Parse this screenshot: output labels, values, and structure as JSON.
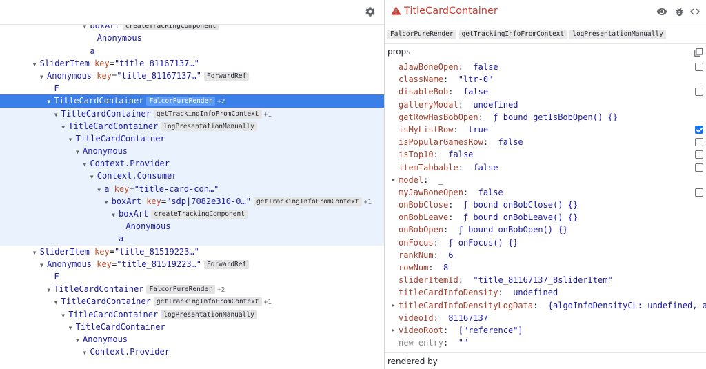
{
  "colors": {
    "selection": "#3b80e8",
    "subtree_highlight": "#eaf2fd",
    "component_name": "#1a1aa6",
    "attr_key": "#c4502b",
    "warning_title": "#d33b2e",
    "checkbox_checked": "#1a73e8"
  },
  "tree": {
    "settings_icon": "gear-icon",
    "rows": [
      {
        "indent": 11,
        "arrow": "",
        "name": "boxArt",
        "attr": [
          {
            "k": "key",
            "v": "\"sdp|7082e310-0…\""
          }
        ],
        "badge": "getTrackingInfoFromContext",
        "extra": "",
        "state": "obscured"
      },
      {
        "indent": 11,
        "arrow": "▼",
        "name": "boxArt",
        "attr": [],
        "badge": "createTrackingComponent",
        "extra": "",
        "state": ""
      },
      {
        "indent": 12,
        "arrow": "",
        "name": "Anonymous",
        "attr": [],
        "badge": "",
        "extra": "",
        "state": ""
      },
      {
        "indent": 11,
        "arrow": "",
        "name": "a",
        "attr": [],
        "badge": "",
        "extra": "",
        "state": ""
      },
      {
        "indent": 4,
        "arrow": "▼",
        "name": "SliderItem",
        "attr": [
          {
            "k": "key",
            "v": "\"title_81167137…\""
          }
        ],
        "badge": "",
        "extra": "",
        "state": ""
      },
      {
        "indent": 5,
        "arrow": "▼",
        "name": "Anonymous",
        "attr": [
          {
            "k": "key",
            "v": "\"title_81167137…\""
          }
        ],
        "badge": "ForwardRef",
        "extra": "",
        "state": ""
      },
      {
        "indent": 6,
        "arrow": "",
        "name": "F",
        "attr": [],
        "badge": "",
        "extra": "",
        "state": ""
      },
      {
        "indent": 6,
        "arrow": "▼",
        "name": "TitleCardContainer",
        "attr": [],
        "badge": "FalcorPureRender",
        "extra": "+2",
        "state": "sel"
      },
      {
        "indent": 7,
        "arrow": "▼",
        "name": "TitleCardContainer",
        "attr": [],
        "badge": "getTrackingInfoFromContext",
        "extra": "+1",
        "state": "sub"
      },
      {
        "indent": 8,
        "arrow": "▼",
        "name": "TitleCardContainer",
        "attr": [],
        "badge": "logPresentationManually",
        "extra": "",
        "state": "sub"
      },
      {
        "indent": 9,
        "arrow": "▼",
        "name": "TitleCardContainer",
        "attr": [],
        "badge": "",
        "extra": "",
        "state": "sub"
      },
      {
        "indent": 10,
        "arrow": "▼",
        "name": "Anonymous",
        "attr": [],
        "badge": "",
        "extra": "",
        "state": "sub"
      },
      {
        "indent": 11,
        "arrow": "▼",
        "name": "Context.Provider",
        "attr": [],
        "badge": "",
        "extra": "",
        "state": "sub"
      },
      {
        "indent": 12,
        "arrow": "▼",
        "name": "Context.Consumer",
        "attr": [],
        "badge": "",
        "extra": "",
        "state": "sub"
      },
      {
        "indent": 13,
        "arrow": "▼",
        "name": "a",
        "attr": [
          {
            "k": "key",
            "v": "\"title-card-con…\""
          }
        ],
        "badge": "",
        "extra": "",
        "state": "sub"
      },
      {
        "indent": 14,
        "arrow": "▼",
        "name": "boxArt",
        "attr": [
          {
            "k": "key",
            "v": "\"sdp|7082e310-0…\""
          }
        ],
        "badge": "getTrackingInfoFromContext",
        "extra": "+1",
        "state": "sub"
      },
      {
        "indent": 15,
        "arrow": "▼",
        "name": "boxArt",
        "attr": [],
        "badge": "createTrackingComponent",
        "extra": "",
        "state": "sub"
      },
      {
        "indent": 16,
        "arrow": "",
        "name": "Anonymous",
        "attr": [],
        "badge": "",
        "extra": "",
        "state": "sub"
      },
      {
        "indent": 15,
        "arrow": "",
        "name": "a",
        "attr": [],
        "badge": "",
        "extra": "",
        "state": "sub"
      },
      {
        "indent": 4,
        "arrow": "▼",
        "name": "SliderItem",
        "attr": [
          {
            "k": "key",
            "v": "\"title_81519223…\""
          }
        ],
        "badge": "",
        "extra": "",
        "state": ""
      },
      {
        "indent": 5,
        "arrow": "▼",
        "name": "Anonymous",
        "attr": [
          {
            "k": "key",
            "v": "\"title_81519223…\""
          }
        ],
        "badge": "ForwardRef",
        "extra": "",
        "state": ""
      },
      {
        "indent": 6,
        "arrow": "",
        "name": "F",
        "attr": [],
        "badge": "",
        "extra": "",
        "state": ""
      },
      {
        "indent": 6,
        "arrow": "▼",
        "name": "TitleCardContainer",
        "attr": [],
        "badge": "FalcorPureRender",
        "extra": "+2",
        "state": ""
      },
      {
        "indent": 7,
        "arrow": "▼",
        "name": "TitleCardContainer",
        "attr": [],
        "badge": "getTrackingInfoFromContext",
        "extra": "+1",
        "state": ""
      },
      {
        "indent": 8,
        "arrow": "▼",
        "name": "TitleCardContainer",
        "attr": [],
        "badge": "logPresentationManually",
        "extra": "",
        "state": ""
      },
      {
        "indent": 9,
        "arrow": "▼",
        "name": "TitleCardContainer",
        "attr": [],
        "badge": "",
        "extra": "",
        "state": ""
      },
      {
        "indent": 10,
        "arrow": "▼",
        "name": "Anonymous",
        "attr": [],
        "badge": "",
        "extra": "",
        "state": ""
      },
      {
        "indent": 11,
        "arrow": "▼",
        "name": "Context.Provider",
        "attr": [],
        "badge": "",
        "extra": "",
        "state": ""
      }
    ]
  },
  "inspector": {
    "title": "TitleCardContainer",
    "warning_icon": "warning-icon",
    "header_icons": [
      "eye-icon",
      "bug-icon",
      "source-code-icon"
    ],
    "hocs": [
      "FalcorPureRender",
      "getTrackingInfoFromContext",
      "logPresentationManually"
    ],
    "props_label": "props",
    "copy_icon": "copy-icon",
    "props": [
      {
        "key": "aJawBoneOpen",
        "value": "false",
        "expand": false,
        "checkbox": "off"
      },
      {
        "key": "className",
        "value": "\"ltr-0\"",
        "expand": false,
        "checkbox": ""
      },
      {
        "key": "disableBob",
        "value": "false",
        "expand": false,
        "checkbox": "off"
      },
      {
        "key": "galleryModal",
        "value": "undefined",
        "expand": false,
        "checkbox": ""
      },
      {
        "key": "getRowHasBobOpen",
        "value": "ƒ bound getIsBobOpen() {}",
        "expand": false,
        "checkbox": ""
      },
      {
        "key": "isMyListRow",
        "value": "true",
        "expand": false,
        "checkbox": "on"
      },
      {
        "key": "isPopularGamesRow",
        "value": "false",
        "expand": false,
        "checkbox": "off"
      },
      {
        "key": "isTop10",
        "value": "false",
        "expand": false,
        "checkbox": "off"
      },
      {
        "key": "itemTabbable",
        "value": "false",
        "expand": false,
        "checkbox": "off"
      },
      {
        "key": "model",
        "value": "_",
        "expand": true,
        "checkbox": ""
      },
      {
        "key": "myJawBoneOpen",
        "value": "false",
        "expand": false,
        "checkbox": "off"
      },
      {
        "key": "onBobClose",
        "value": "ƒ bound onBobClose() {}",
        "expand": false,
        "checkbox": ""
      },
      {
        "key": "onBobLeave",
        "value": "ƒ bound onBobLeave() {}",
        "expand": false,
        "checkbox": ""
      },
      {
        "key": "onBobOpen",
        "value": "ƒ bound onBobOpen() {}",
        "expand": false,
        "checkbox": ""
      },
      {
        "key": "onFocus",
        "value": "ƒ onFocus() {}",
        "expand": false,
        "checkbox": ""
      },
      {
        "key": "rankNum",
        "value": "6",
        "expand": false,
        "checkbox": ""
      },
      {
        "key": "rowNum",
        "value": "8",
        "expand": false,
        "checkbox": ""
      },
      {
        "key": "sliderItemId",
        "value": "\"title_81167137_8sliderItem\"",
        "expand": false,
        "checkbox": ""
      },
      {
        "key": "titleCardInfoDensity",
        "value": "undefined",
        "expand": false,
        "checkbox": ""
      },
      {
        "key": "titleCardInfoDensityLogData",
        "value": "{algoInfoDensityCL: undefined, algoI…",
        "expand": true,
        "checkbox": ""
      },
      {
        "key": "videoId",
        "value": "81167137",
        "expand": false,
        "checkbox": ""
      },
      {
        "key": "videoRoot",
        "value": "[\"reference\"]",
        "expand": true,
        "checkbox": ""
      },
      {
        "key": "new entry",
        "value": "\"\"",
        "expand": false,
        "checkbox": "",
        "ghost": true
      }
    ],
    "rendered_by_label": "rendered by"
  }
}
